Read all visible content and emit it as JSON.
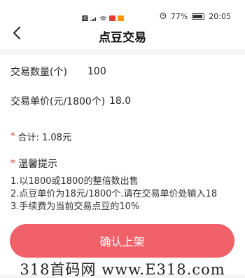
{
  "status_bar": {
    "battery_percent": "77%",
    "time": "20:05",
    "chip_hd": "HD",
    "accent_chip_colors": [
      "#e53935",
      "#ff9800"
    ]
  },
  "header": {
    "title": "点豆交易",
    "back_icon": "chevron-left-icon"
  },
  "form": {
    "quantity_label": "交易数量(个)",
    "quantity_value": "100",
    "price_label": "交易单价(元/1800个)",
    "price_value": "18.0"
  },
  "summary": {
    "star": "*",
    "total_text": "合计:  1.08元"
  },
  "tips": {
    "star": "*",
    "title": "温馨提示",
    "items": [
      "1.以1800或1800的整倍数出售",
      "2.点豆单价为18元/1800个.请在交易单价处输入18",
      "3.手续费为当前交易点豆的10%"
    ]
  },
  "actions": {
    "confirm_label": "确认上架",
    "button_color": "#f0616a"
  },
  "watermark": {
    "text": "318首码网 www.E318.com"
  }
}
